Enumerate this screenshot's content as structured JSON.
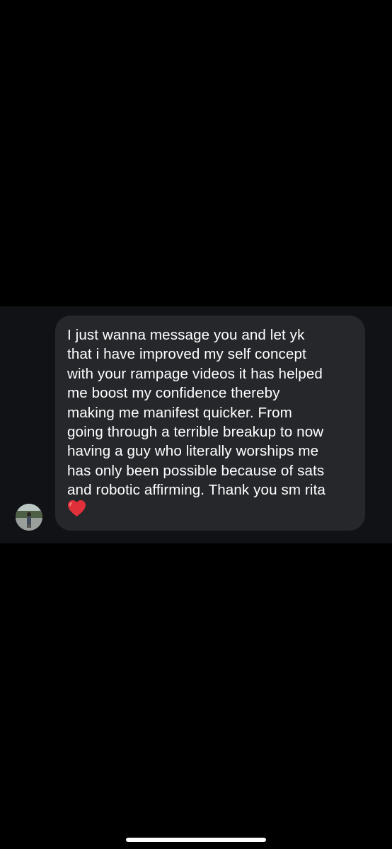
{
  "conversation": {
    "message": {
      "text": "I just wanna message you and let yk\nthat i have improved my self concept\nwith your rampage videos it has helped\nme boost my confidence thereby\nmaking me manifest quicker. From\ngoing through a terrible breakup to now\nhaving a guy who literally worships me\nhas only been possible because of sats\nand robotic affirming. Thank you sm rita",
      "emoji": "red-heart-icon"
    },
    "sender_avatar": "avatar"
  },
  "colors": {
    "background": "#000000",
    "strip": "#111215",
    "bubble": "#26272b",
    "text": "#ffffff",
    "heart": "#e0303a"
  }
}
